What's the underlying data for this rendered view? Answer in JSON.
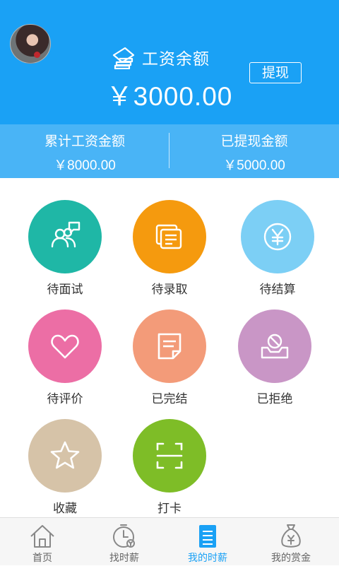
{
  "header": {
    "title": "工资余额",
    "balance": "￥3000.00",
    "withdraw_label": "提现"
  },
  "stats": [
    {
      "label": "累计工资金额",
      "value": "￥8000.00"
    },
    {
      "label": "已提现金额",
      "value": "￥5000.00"
    }
  ],
  "grid": [
    {
      "label": "待面试",
      "icon": "interview-icon",
      "color": "#1fb7a6"
    },
    {
      "label": "待录取",
      "icon": "document-stack-icon",
      "color": "#f59a0e"
    },
    {
      "label": "待结算",
      "icon": "yen-coin-icon",
      "color": "#7ccff5"
    },
    {
      "label": "待评价",
      "icon": "heart-icon",
      "color": "#ec6ea5"
    },
    {
      "label": "已完结",
      "icon": "note-icon",
      "color": "#f39b79"
    },
    {
      "label": "已拒绝",
      "icon": "rejected-box-icon",
      "color": "#c996c6"
    },
    {
      "label": "收藏",
      "icon": "star-icon",
      "color": "#d6c3a8"
    },
    {
      "label": "打卡",
      "icon": "scan-icon",
      "color": "#7ebd27"
    }
  ],
  "tabs": [
    {
      "label": "首页",
      "icon": "home-icon",
      "active": false
    },
    {
      "label": "找时薪",
      "icon": "clock-icon",
      "active": false
    },
    {
      "label": "我的时薪",
      "icon": "list-doc-icon",
      "active": true
    },
    {
      "label": "我的赏金",
      "icon": "money-bag-icon",
      "active": false
    }
  ],
  "colors": {
    "header_bg": "#1aa1f5",
    "stats_bg": "#49b4f6",
    "active_tab": "#1aa1f5"
  }
}
